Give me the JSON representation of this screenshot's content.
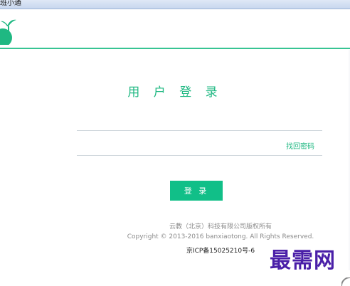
{
  "window": {
    "title": "班小通"
  },
  "header": {
    "logo_icon": "leaf-sprout-icon",
    "accent_color": "#37c493"
  },
  "login": {
    "title": "用 户 登 录",
    "forgot_password": "找回密码",
    "login_button": "登 录",
    "button_color": "#11bf88"
  },
  "footer": {
    "line1": "云教（北京）科技有限公司版权所有",
    "line2": "Copyright © 2013-2016 banxiaotong. All Rights Reserved.",
    "line3": "京ICP备15025210号-6"
  },
  "watermark": {
    "text": "最需网"
  }
}
